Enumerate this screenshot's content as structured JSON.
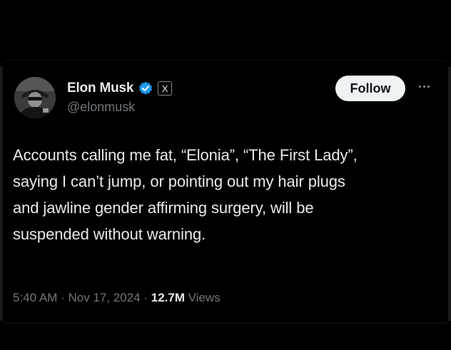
{
  "author": {
    "display_name": "Elon Musk",
    "handle": "@elonmusk",
    "verified": true,
    "affiliate_badge": "X"
  },
  "actions": {
    "follow_label": "Follow",
    "more_icon": "more-horizontal-icon"
  },
  "tweet": {
    "text": "Accounts calling me fat, “Elonia”, “The First Lady”, saying I can’t jump, or pointing out my hair plugs and jawline gender affirming surgery, will be suspended without warning.",
    "lines": [
      "Accounts calling me fat, “Elonia”, “The First Lady”,",
      "saying I can’t jump, or pointing out my hair plugs",
      "and jawline gender affirming surgery, will be",
      "suspended without warning."
    ]
  },
  "meta": {
    "time": "5:40 AM",
    "separator": "·",
    "date": "Nov 17, 2024",
    "views_count": "12.7M",
    "views_label": "Views"
  },
  "colors": {
    "background": "#000000",
    "text_primary": "#e7e9ea",
    "text_secondary": "#71767b",
    "verified_blue": "#1d9bf0",
    "follow_bg": "#eff3f4"
  }
}
